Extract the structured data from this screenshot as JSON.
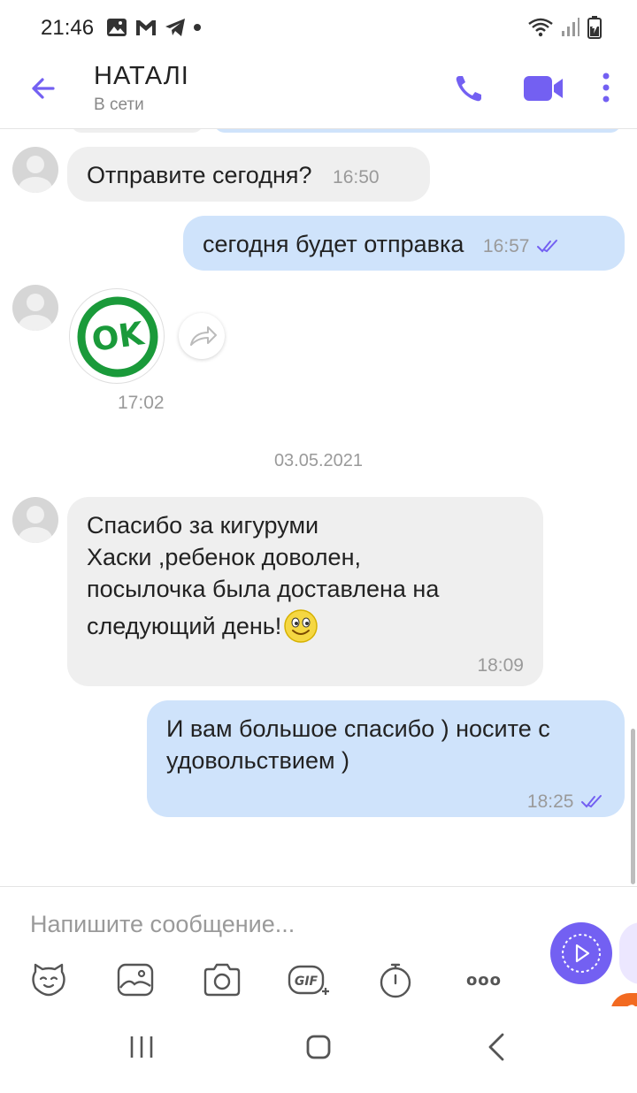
{
  "status_bar": {
    "time": "21:46"
  },
  "header": {
    "contact_name": "НАТАЛІ",
    "contact_status": "В сети"
  },
  "messages": [
    {
      "direction": "in",
      "text": "Отправите сегодня?",
      "time": "16:50"
    },
    {
      "direction": "out",
      "text": "сегодня будет отправка",
      "time": "16:57"
    },
    {
      "direction": "in",
      "type": "sticker",
      "sticker_text": "OK",
      "time": "17:02"
    },
    {
      "direction": "in",
      "lines": [
        "Спасибо за кигуруми",
        "Хаски ,ребенок доволен,",
        "посылочка была доставлена на",
        "следующий день!"
      ],
      "time": "18:09"
    },
    {
      "direction": "out",
      "lines": [
        "И вам большое спасибо ) носите с",
        "удовольствием )"
      ],
      "time": "18:25"
    }
  ],
  "date_separator": "03.05.2021",
  "composer": {
    "placeholder": "Напишите сообщение...",
    "gif_label": "GIF",
    "more_label": "ooo"
  },
  "colors": {
    "accent": "#7360f2",
    "outgoing_bubble": "#cfe3fb",
    "incoming_bubble": "#efefef",
    "sticker_green": "#1a9a3a",
    "orange": "#f26a21"
  }
}
